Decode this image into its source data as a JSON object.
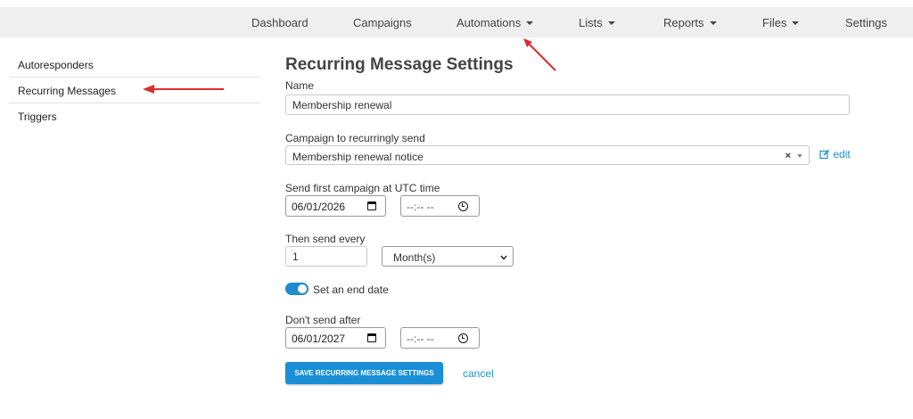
{
  "nav": {
    "dashboard": "Dashboard",
    "campaigns": "Campaigns",
    "automations": "Automations",
    "lists": "Lists",
    "reports": "Reports",
    "files": "Files",
    "settings": "Settings"
  },
  "sidebar": {
    "items": [
      {
        "label": "Autoresponders"
      },
      {
        "label": "Recurring Messages"
      },
      {
        "label": "Triggers"
      }
    ]
  },
  "form": {
    "title": "Recurring Message Settings",
    "name_label": "Name",
    "name_value": "Membership renewal",
    "campaign_label": "Campaign to recurringly send",
    "campaign_value": "Membership renewal notice",
    "campaign_clear": "×",
    "edit_label": "edit",
    "first_send_label": "Send first campaign at UTC time",
    "first_send_date": "06/01/2026",
    "first_send_time": "--:-- --",
    "interval_label": "Then send every",
    "interval_value": "1",
    "interval_unit": "Month(s)",
    "end_date_toggle_label": "Set an end date",
    "end_date_toggle_on": true,
    "dont_send_label": "Don't send after",
    "end_date": "06/01/2027",
    "end_time": "--:-- --",
    "save_label": "SAVE RECURRING MESSAGE SETTINGS",
    "cancel_label": "cancel"
  },
  "colors": {
    "accent": "#1a8fd6",
    "annotation_arrow": "#e02b2b",
    "nav_background": "#efefef"
  }
}
